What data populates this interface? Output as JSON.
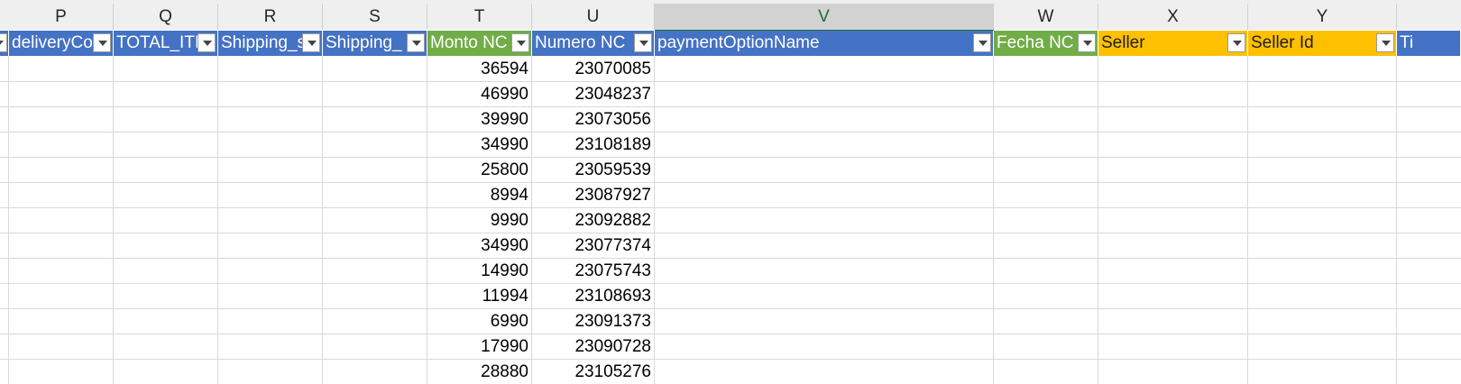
{
  "sheet": {
    "column_letters": [
      "P",
      "Q",
      "R",
      "S",
      "T",
      "U",
      "V",
      "W",
      "X",
      "Y"
    ],
    "selected_column": "V",
    "headers": [
      {
        "label": "deliveryCo",
        "color": "blue"
      },
      {
        "label": "TOTAL_ITI",
        "color": "blue"
      },
      {
        "label": "Shipping_s",
        "color": "blue"
      },
      {
        "label": "Shipping_",
        "color": "blue"
      },
      {
        "label": "Monto NC",
        "color": "green"
      },
      {
        "label": "Numero NC",
        "color": "blue"
      },
      {
        "label": "paymentOptionName",
        "color": "blue"
      },
      {
        "label": "Fecha NC",
        "color": "green"
      },
      {
        "label": "Seller",
        "color": "yellow"
      },
      {
        "label": "Seller Id",
        "color": "yellow"
      },
      {
        "label": "Ti",
        "color": "blue"
      }
    ],
    "rows": [
      {
        "monto_nc": "36594",
        "numero_nc": "23070085"
      },
      {
        "monto_nc": "46990",
        "numero_nc": "23048237"
      },
      {
        "monto_nc": "39990",
        "numero_nc": "23073056"
      },
      {
        "monto_nc": "34990",
        "numero_nc": "23108189"
      },
      {
        "monto_nc": "25800",
        "numero_nc": "23059539"
      },
      {
        "monto_nc": "8994",
        "numero_nc": "23087927"
      },
      {
        "monto_nc": "9990",
        "numero_nc": "23092882"
      },
      {
        "monto_nc": "34990",
        "numero_nc": "23077374"
      },
      {
        "monto_nc": "14990",
        "numero_nc": "23075743"
      },
      {
        "monto_nc": "11994",
        "numero_nc": "23108693"
      },
      {
        "monto_nc": "6990",
        "numero_nc": "23091373"
      },
      {
        "monto_nc": "17990",
        "numero_nc": "23090728"
      },
      {
        "monto_nc": "28880",
        "numero_nc": "23105276"
      }
    ],
    "colors": {
      "blue_header": "#4472c4",
      "green_header": "#70ad47",
      "yellow_header": "#ffc000",
      "selected_column_text": "#1d6b3a"
    }
  }
}
